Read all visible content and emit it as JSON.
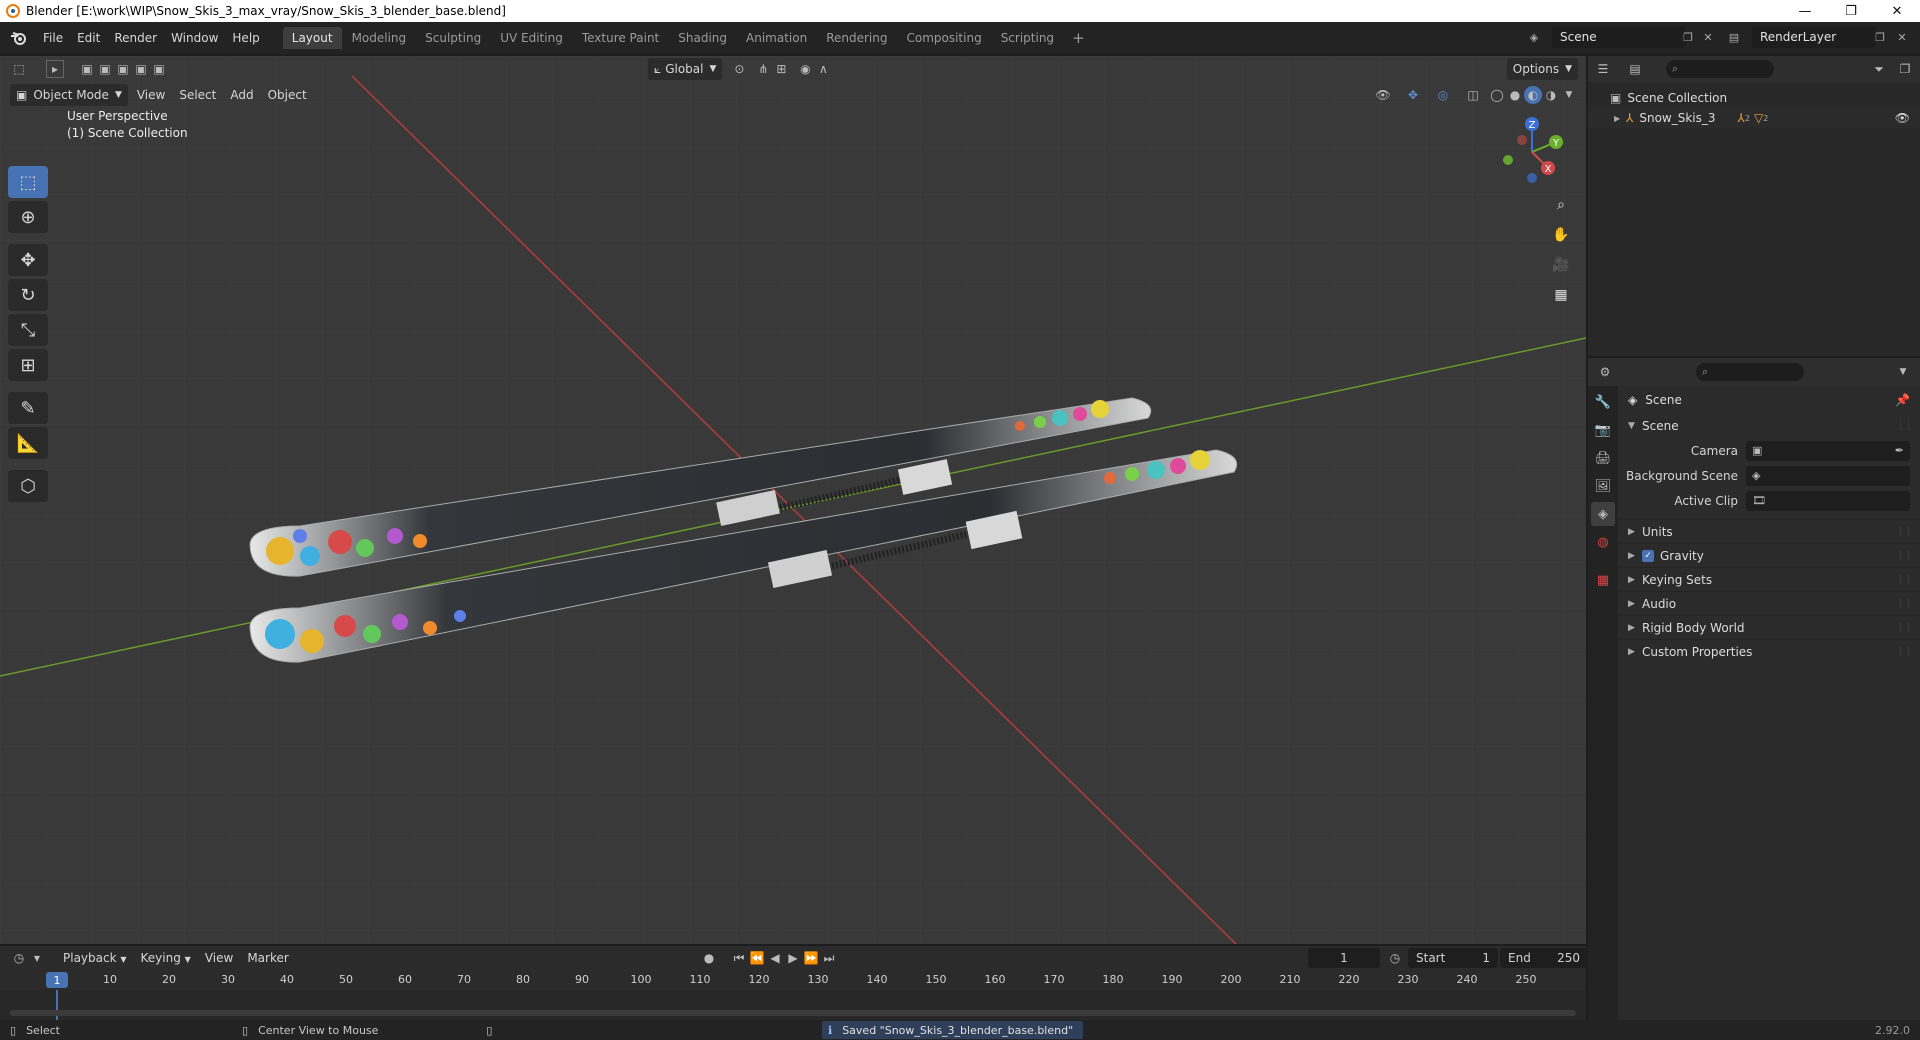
{
  "window": {
    "title": "Blender [E:\\work\\WIP\\Snow_Skis_3_max_vray/Snow_Skis_3_blender_base.blend]",
    "controls": [
      "—",
      "❐",
      "✕"
    ]
  },
  "menus": [
    "File",
    "Edit",
    "Render",
    "Window",
    "Help"
  ],
  "workspaces": {
    "active": "Layout",
    "tabs": [
      "Layout",
      "Modeling",
      "Sculpting",
      "UV Editing",
      "Texture Paint",
      "Shading",
      "Animation",
      "Rendering",
      "Compositing",
      "Scripting"
    ]
  },
  "scene_selector": {
    "value": "Scene"
  },
  "renderlayer_selector": {
    "value": "RenderLayer"
  },
  "viewport": {
    "transform_orientation": "Global",
    "options_label": "Options",
    "mode": "Object Mode",
    "menus": [
      "View",
      "Select",
      "Add",
      "Object"
    ],
    "overlay_text": {
      "line1": "User Perspective",
      "line2": "(1) Scene Collection"
    },
    "axis_labels": {
      "x": "X",
      "y": "Y",
      "z": "Z"
    }
  },
  "outliner": {
    "root": "Scene Collection",
    "items": [
      {
        "name": "Snow_Skis_3",
        "badge1": "2",
        "badge2": "2"
      }
    ]
  },
  "properties": {
    "context": "Scene",
    "panel": "Scene",
    "fields": [
      {
        "label": "Camera"
      },
      {
        "label": "Background Scene"
      },
      {
        "label": "Active Clip"
      }
    ],
    "subpanels": [
      {
        "label": "Units",
        "checkbox": false
      },
      {
        "label": "Gravity",
        "checkbox": true
      },
      {
        "label": "Keying Sets",
        "checkbox": false
      },
      {
        "label": "Audio",
        "checkbox": false
      },
      {
        "label": "Rigid Body World",
        "checkbox": false
      },
      {
        "label": "Custom Properties",
        "checkbox": false
      }
    ]
  },
  "timeline": {
    "menus": [
      "Playback",
      "Keying",
      "View",
      "Marker"
    ],
    "current_frame": "1",
    "start_label": "Start",
    "start_value": "1",
    "end_label": "End",
    "end_value": "250",
    "ruler": [
      "10",
      "20",
      "30",
      "40",
      "50",
      "60",
      "70",
      "80",
      "90",
      "100",
      "110",
      "120",
      "130",
      "140",
      "150",
      "160",
      "170",
      "180",
      "190",
      "200",
      "210",
      "220",
      "230",
      "240",
      "250"
    ],
    "cursor_label": "1"
  },
  "statusbar": {
    "left_action": "Select",
    "middle_action": "Center View to Mouse",
    "message": "Saved \"Snow_Skis_3_blender_base.blend\"",
    "version": "2.92.0"
  }
}
